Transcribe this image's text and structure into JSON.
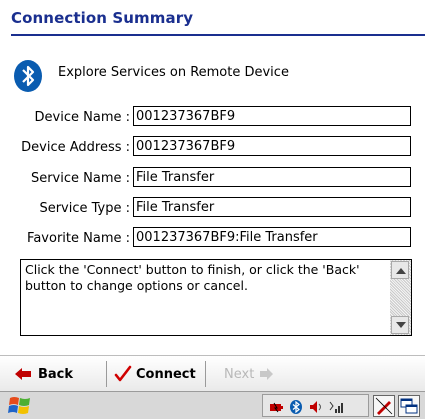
{
  "header": {
    "title": "Connection Summary"
  },
  "intro": {
    "text": "Explore Services on Remote Device"
  },
  "fields": [
    {
      "label": "Device Name :",
      "value": "001237367BF9"
    },
    {
      "label": "Device Address :",
      "value": "001237367BF9"
    },
    {
      "label": "Service Name :",
      "value": "File Transfer"
    },
    {
      "label": "Service Type :",
      "value": "File Transfer"
    },
    {
      "label": "Favorite Name :",
      "value": "001237367BF9:File Transfer"
    }
  ],
  "info": {
    "text": "Click the 'Connect' button to finish, or click the 'Back' button to change options or cancel."
  },
  "toolbar": {
    "back_label": "Back",
    "connect_label": "Connect",
    "next_label": "Next"
  },
  "colors": {
    "title": "#1a2f8f",
    "bluetooth": "#0a5cb0",
    "connect_check": "#d00000",
    "back_arrow": "#c00000"
  },
  "icons": [
    "bluetooth-icon",
    "back-arrow-icon",
    "checkmark-icon",
    "next-arrow-icon",
    "start-icon",
    "battery-icon",
    "tray-bluetooth-icon",
    "volume-icon",
    "signal-icon",
    "pen-icon",
    "window-switch-icon"
  ]
}
